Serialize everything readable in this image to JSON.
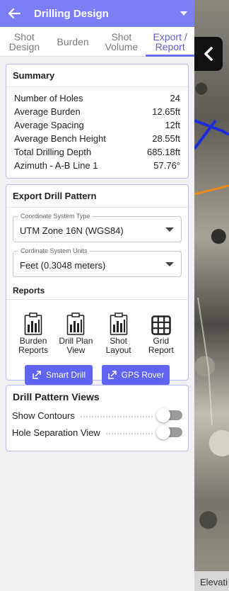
{
  "header": {
    "title": "Drilling Design"
  },
  "tabs": [
    {
      "label": "Shot Design"
    },
    {
      "label": "Burden"
    },
    {
      "label": "Shot Volume"
    },
    {
      "label": "Export / Report"
    }
  ],
  "summary": {
    "title": "Summary",
    "rows": [
      {
        "label": "Number of Holes",
        "value": "24"
      },
      {
        "label": "Average Burden",
        "value": "12.65ft"
      },
      {
        "label": "Average Spacing",
        "value": "12ft"
      },
      {
        "label": "Average Bench Height",
        "value": "28.55ft"
      },
      {
        "label": "Total Drilling Depth",
        "value": "685.18ft"
      },
      {
        "label": "Azimuth - A-B Line 1",
        "value": "57.76°"
      }
    ]
  },
  "export": {
    "title": "Export Drill Pattern",
    "coordinate_system_type": {
      "label": "Coordinate System Type",
      "value": "UTM Zone 16N (WGS84)"
    },
    "coordinate_system_units": {
      "label": "Cordinate System Units",
      "value": "Feet (0.3048 meters)"
    },
    "reports_title": "Reports",
    "reports": [
      {
        "label": "Burden Reports",
        "icon": "report-clipboard-icon"
      },
      {
        "label": "Drill Plan View",
        "icon": "report-clipboard-icon"
      },
      {
        "label": "Shot Layout",
        "icon": "report-clipboard-icon"
      },
      {
        "label": "Grid Report",
        "icon": "grid-icon"
      }
    ],
    "buttons": [
      {
        "label": "Smart Drill",
        "icon": "export-arrow-icon"
      },
      {
        "label": "GPS Rover",
        "icon": "export-arrow-icon"
      }
    ]
  },
  "views": {
    "title": "Drill Pattern Views",
    "toggles": [
      {
        "label": "Show Contours",
        "on": false
      },
      {
        "label": "Hole Separation View",
        "on": false
      }
    ]
  },
  "map": {
    "elevation_label": "Elevati"
  },
  "colors": {
    "accent": "#7b7ef4",
    "button": "#5f64f2",
    "card_border": "#b8bbf3"
  }
}
